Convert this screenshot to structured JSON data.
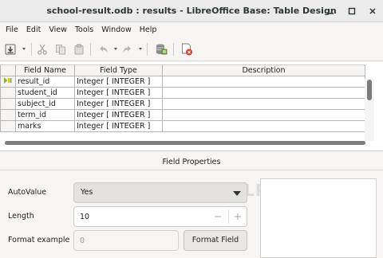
{
  "window": {
    "title": "school-result.odb : results - LibreOffice Base: Table Design"
  },
  "menu": [
    "File",
    "Edit",
    "View",
    "Tools",
    "Window",
    "Help"
  ],
  "grid": {
    "headers": [
      "Field Name",
      "Field Type",
      "Description"
    ],
    "rows": [
      {
        "name": "result_id",
        "type": "Integer [ INTEGER ]",
        "description": "",
        "primary_key": true
      },
      {
        "name": "student_id",
        "type": "Integer [ INTEGER ]",
        "description": "",
        "primary_key": false
      },
      {
        "name": "subject_id",
        "type": "Integer [ INTEGER ]",
        "description": "",
        "primary_key": false
      },
      {
        "name": "term_id",
        "type": "Integer [ INTEGER ]",
        "description": "",
        "primary_key": false
      },
      {
        "name": "marks",
        "type": "Integer [ INTEGER ]",
        "description": "",
        "primary_key": false
      }
    ]
  },
  "watermark": "LIBREOFFICEHELP.COM",
  "field_properties": {
    "title": "Field Properties",
    "autovalue": {
      "label": "AutoValue",
      "value": "Yes"
    },
    "length": {
      "label": "Length",
      "value": "10"
    },
    "format_example": {
      "label": "Format example",
      "value": "0",
      "button": "Format Field"
    }
  },
  "colors": {
    "accent_red": "#d9412d",
    "key_icon_green": "#8ab33d",
    "key_icon_yellow": "#f0c419"
  }
}
